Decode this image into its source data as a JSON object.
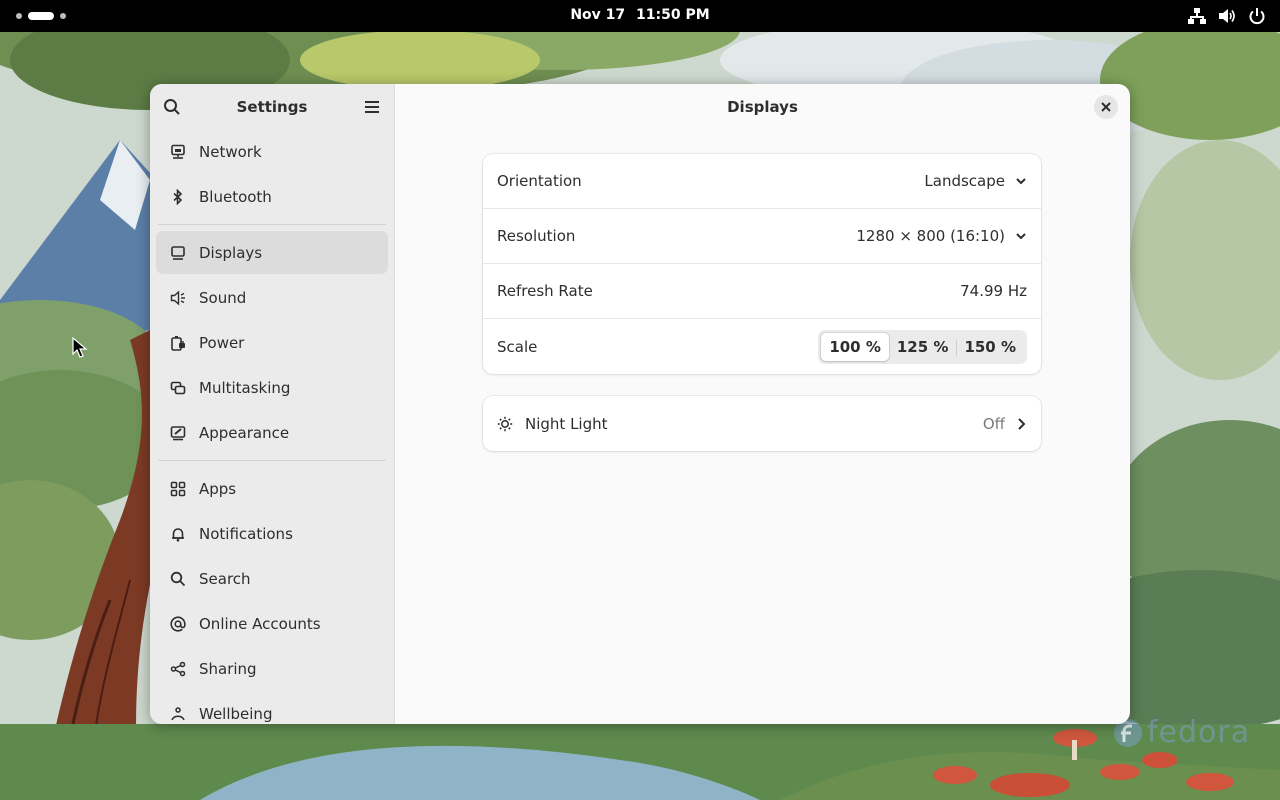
{
  "topbar": {
    "date": "Nov 17",
    "time": "11:50 PM",
    "tray_icons": [
      "network-wired-icon",
      "volume-icon",
      "power-icon"
    ]
  },
  "window": {
    "sidebar": {
      "title": "Settings",
      "group1": [
        {
          "label": "Network",
          "icon": "network-wired-icon"
        },
        {
          "label": "Bluetooth",
          "icon": "bluetooth-icon"
        }
      ],
      "group2": [
        {
          "label": "Displays",
          "icon": "display-icon",
          "active": true
        },
        {
          "label": "Sound",
          "icon": "speaker-icon"
        },
        {
          "label": "Power",
          "icon": "battery-plug-icon"
        },
        {
          "label": "Multitasking",
          "icon": "multitasking-icon"
        },
        {
          "label": "Appearance",
          "icon": "appearance-icon"
        }
      ],
      "group3": [
        {
          "label": "Apps",
          "icon": "apps-grid-icon"
        },
        {
          "label": "Notifications",
          "icon": "bell-icon"
        },
        {
          "label": "Search",
          "icon": "search-icon"
        },
        {
          "label": "Online Accounts",
          "icon": "at-sign-icon"
        },
        {
          "label": "Sharing",
          "icon": "share-icon"
        },
        {
          "label": "Wellbeing",
          "icon": "wellbeing-icon"
        }
      ]
    },
    "content": {
      "title": "Displays",
      "display_settings": {
        "orientation": {
          "label": "Orientation",
          "value": "Landscape"
        },
        "resolution": {
          "label": "Resolution",
          "value": "1280 × 800 (16:10)"
        },
        "refresh_rate": {
          "label": "Refresh Rate",
          "value": "74.99 Hz"
        },
        "scale": {
          "label": "Scale",
          "options": [
            "100 %",
            "125 %",
            "150 %"
          ],
          "selected": "100 %"
        }
      },
      "night_light": {
        "label": "Night Light",
        "value": "Off"
      }
    }
  },
  "desktop": {
    "watermark": "fedora"
  }
}
